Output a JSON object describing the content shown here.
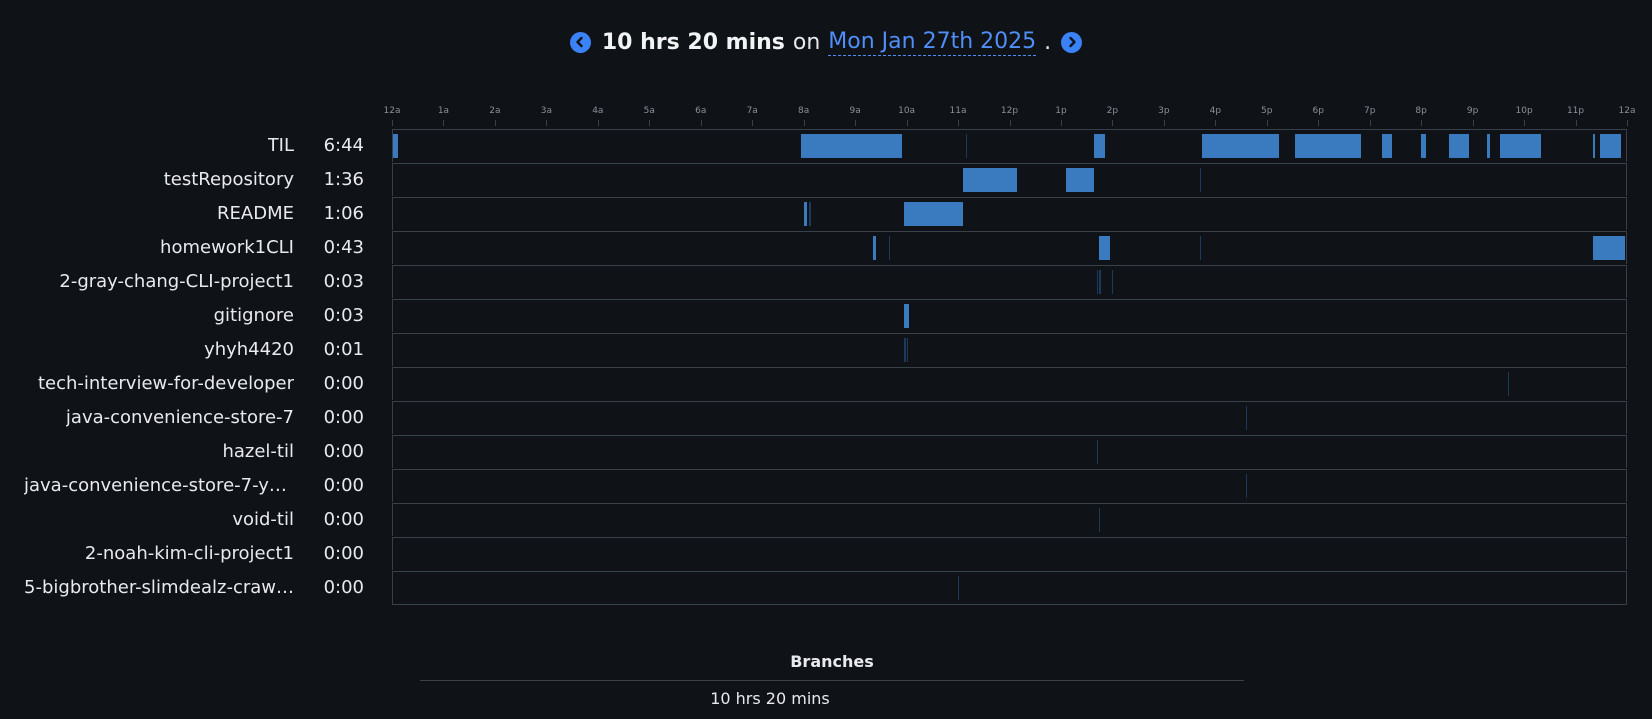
{
  "header": {
    "total": "10 hrs 20 mins",
    "on_word": "on",
    "date": "Mon Jan 27th 2025",
    "period": "."
  },
  "axis": {
    "ticks": [
      "12a",
      "1a",
      "2a",
      "3a",
      "4a",
      "5a",
      "6a",
      "7a",
      "8a",
      "9a",
      "10a",
      "11a",
      "12p",
      "1p",
      "2p",
      "3p",
      "4p",
      "5p",
      "6p",
      "7p",
      "8p",
      "9p",
      "10p",
      "11p",
      "12a"
    ]
  },
  "colors": {
    "background": "#0f1217",
    "bar": "#3a7bbf",
    "accent": "#3b82f6",
    "link": "#4f8ff7"
  },
  "projects": [
    {
      "name": "TIL",
      "time": "6:44",
      "segments": [
        [
          0.0,
          0.1
        ],
        [
          7.95,
          8.35
        ],
        [
          8.35,
          9.35
        ],
        [
          9.35,
          9.9
        ],
        [
          11.15,
          11.17
        ],
        [
          13.65,
          13.85
        ],
        [
          15.75,
          17.25
        ],
        [
          17.55,
          18.85
        ],
        [
          19.25,
          19.45
        ],
        [
          20.0,
          20.1
        ],
        [
          20.55,
          20.95
        ],
        [
          21.3,
          21.35
        ],
        [
          21.55,
          22.35
        ],
        [
          23.35,
          23.4
        ],
        [
          23.5,
          23.9
        ]
      ]
    },
    {
      "name": "testRepository",
      "time": "1:36",
      "segments": [
        [
          11.1,
          12.15
        ],
        [
          13.1,
          13.65
        ],
        [
          15.7,
          15.73
        ]
      ]
    },
    {
      "name": "README",
      "time": "1:06",
      "segments": [
        [
          8.0,
          8.05
        ],
        [
          8.1,
          8.13
        ],
        [
          9.95,
          10.05
        ],
        [
          10.05,
          11.1
        ]
      ]
    },
    {
      "name": "homework1CLI",
      "time": "0:43",
      "segments": [
        [
          9.35,
          9.4
        ],
        [
          9.65,
          9.67
        ],
        [
          13.75,
          13.8
        ],
        [
          13.8,
          13.95
        ],
        [
          15.7,
          15.73
        ],
        [
          23.35,
          23.55
        ],
        [
          23.55,
          23.99
        ]
      ]
    },
    {
      "name": "2-gray-chang-CLI-project1",
      "time": "0:03",
      "segments": [
        [
          13.7,
          13.73
        ],
        [
          13.75,
          13.78
        ],
        [
          14.0,
          14.02
        ]
      ]
    },
    {
      "name": "gitignore",
      "time": "0:03",
      "segments": [
        [
          9.95,
          10.0
        ],
        [
          10.0,
          10.05
        ]
      ]
    },
    {
      "name": "yhyh4420",
      "time": "0:01",
      "segments": [
        [
          9.95,
          9.98
        ],
        [
          10.0,
          10.02
        ]
      ]
    },
    {
      "name": "tech-interview-for-developer",
      "time": "0:00",
      "segments": [
        [
          21.7,
          21.72
        ]
      ]
    },
    {
      "name": "java-convenience-store-7",
      "time": "0:00",
      "segments": [
        [
          16.6,
          16.62
        ]
      ]
    },
    {
      "name": "hazel-til",
      "time": "0:00",
      "segments": [
        [
          13.7,
          13.72
        ]
      ]
    },
    {
      "name": "java-convenience-store-7-yh…",
      "time": "0:00",
      "segments": [
        [
          16.6,
          16.62
        ]
      ]
    },
    {
      "name": "void-til",
      "time": "0:00",
      "segments": [
        [
          13.75,
          13.77
        ]
      ]
    },
    {
      "name": "2-noah-kim-cli-project1",
      "time": "0:00",
      "segments": []
    },
    {
      "name": "5-bigbrother-slimdealz-craw…",
      "time": "0:00",
      "segments": [
        [
          11.0,
          11.02
        ]
      ]
    }
  ],
  "branches": {
    "title": "Branches",
    "total": "10 hrs 20 mins"
  }
}
